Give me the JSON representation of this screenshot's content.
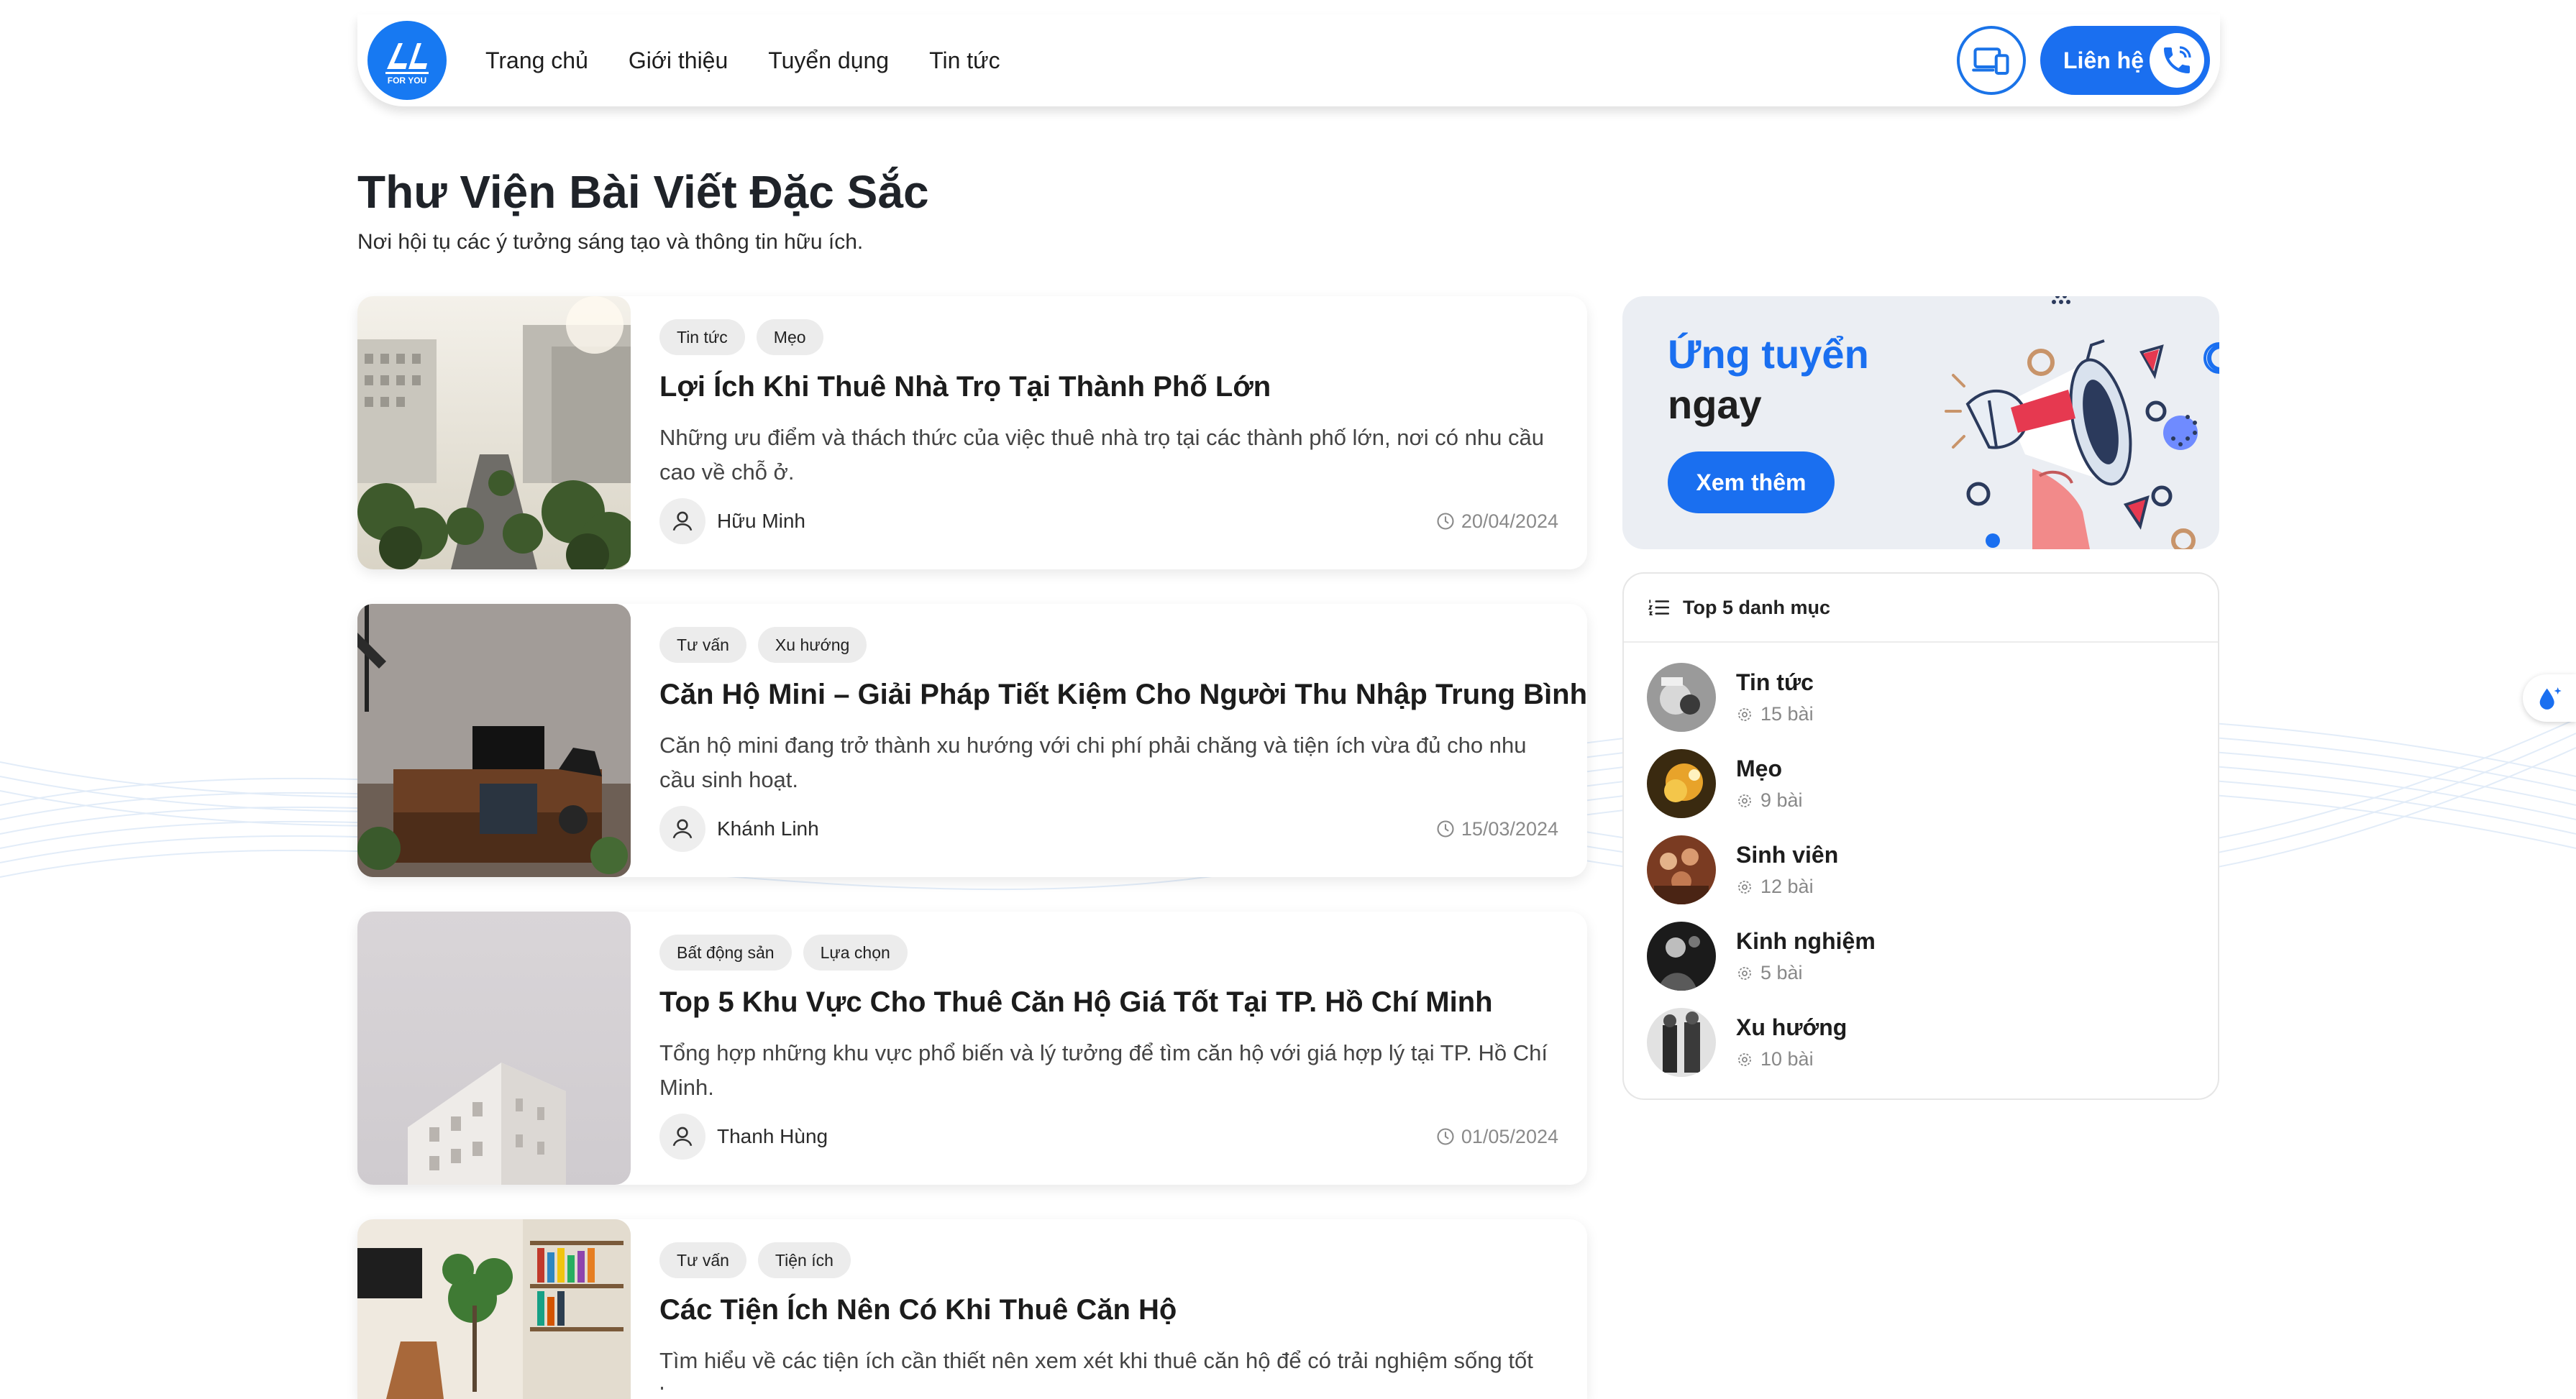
{
  "nav": {
    "logo_text": "FOR YOU",
    "links": [
      "Trang chủ",
      "Giới thiệu",
      "Tuyển dụng",
      "Tin tức"
    ],
    "contact_label": "Liên hệ"
  },
  "hero": {
    "title": "Thư Viện Bài Viết Đặc Sắc",
    "subtitle": "Nơi hội tụ các ý tưởng sáng tạo và thông tin hữu ích."
  },
  "articles": [
    {
      "tags": [
        "Tin tức",
        "Mẹo"
      ],
      "title": "Lợi Ích Khi Thuê Nhà Trọ Tại Thành Phố Lớn",
      "desc": "Những ưu điểm và thách thức của việc thuê nhà trọ tại các thành phố lớn, nơi có nhu cầu cao về chỗ ở.",
      "author": "Hữu Minh",
      "date": "20/04/2024"
    },
    {
      "tags": [
        "Tư vấn",
        "Xu hướng"
      ],
      "title": "Căn Hộ Mini – Giải Pháp Tiết Kiệm Cho Người Thu Nhập Trung Bình",
      "desc": "Căn hộ mini đang trở thành xu hướng với chi phí phải chăng và tiện ích vừa đủ cho nhu cầu sinh hoạt.",
      "author": "Khánh Linh",
      "date": "15/03/2024"
    },
    {
      "tags": [
        "Bất động sản",
        "Lựa chọn"
      ],
      "title": "Top 5 Khu Vực Cho Thuê Căn Hộ Giá Tốt Tại TP. Hồ Chí Minh",
      "desc": "Tổng hợp những khu vực phổ biến và lý tưởng để tìm căn hộ với giá hợp lý tại TP. Hồ Chí Minh.",
      "author": "Thanh Hùng",
      "date": "01/05/2024"
    },
    {
      "tags": [
        "Tư vấn",
        "Tiện ích"
      ],
      "title": "Các Tiện Ích Nên Có Khi Thuê Căn Hộ",
      "desc": "Tìm hiểu về các tiện ích cần thiết nên xem xét khi thuê căn hộ để có trải nghiệm sống tốt hơn.",
      "author": "",
      "date": ""
    }
  ],
  "promo": {
    "title_line1": "Ứng tuyển",
    "title_line2": "ngay",
    "button": "Xem thêm"
  },
  "categories": {
    "header": "Top 5 danh mục",
    "items": [
      {
        "name": "Tin tức",
        "count": "15 bài"
      },
      {
        "name": "Mẹo",
        "count": "9 bài"
      },
      {
        "name": "Sinh viên",
        "count": "12 bài"
      },
      {
        "name": "Kinh nghiệm",
        "count": "5 bài"
      },
      {
        "name": "Xu hướng",
        "count": "10 bài"
      }
    ]
  },
  "colors": {
    "primary": "#1a6ff0",
    "text": "#1f2329",
    "muted": "#8a8a8a",
    "tag_bg": "#ececec"
  }
}
